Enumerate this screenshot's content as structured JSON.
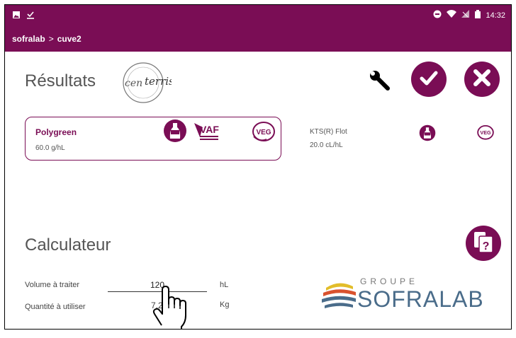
{
  "status": {
    "time": "14:32"
  },
  "breadcrumb": {
    "root": "sofralab",
    "separator": ">",
    "current": "cuve2"
  },
  "results": {
    "title": "Résultats",
    "badge_text": "terris"
  },
  "products": [
    {
      "name": "Polygreen",
      "dose": "60.0 g/hL",
      "badges": [
        "allergen-free-icon",
        "vaf-icon",
        "vegan-icon"
      ],
      "selected": true
    },
    {
      "name": "KTS(R) Flot",
      "dose": "20.0 cL/hL",
      "badges": [
        "allergen-free-icon",
        "vegan-icon"
      ],
      "selected": false
    }
  ],
  "badges": {
    "vaf": "VAF",
    "veg": "VEG"
  },
  "calculator": {
    "title": "Calculateur",
    "volume_label": "Volume à traiter",
    "volume_value": "120",
    "volume_unit": "hL",
    "quantity_label": "Quantité à utiliser",
    "quantity_value": "7.2",
    "quantity_unit": "Kg"
  },
  "logo": {
    "groupe": "GROUPE",
    "name": "SOFRALAB"
  },
  "colors": {
    "primary": "#7a0d55",
    "text": "#555555",
    "logo_blue": "#4a6c8a"
  }
}
